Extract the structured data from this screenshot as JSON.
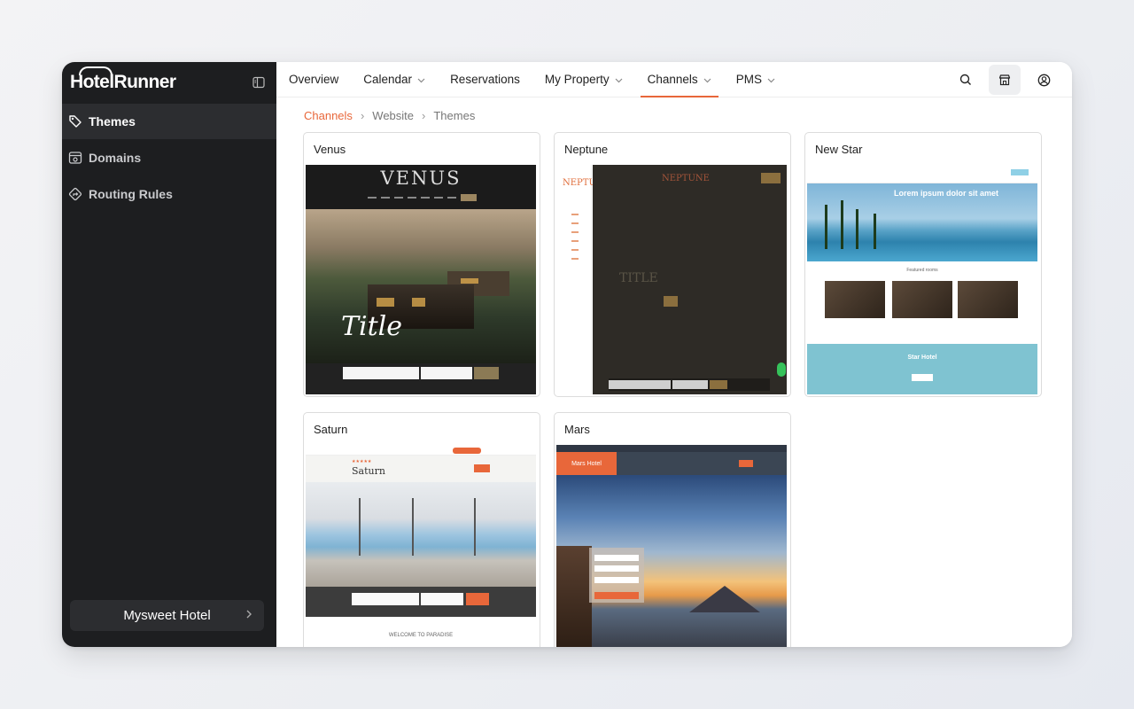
{
  "app": {
    "logo": "HotelRunner"
  },
  "sidebar": {
    "items": [
      {
        "label": "Themes",
        "icon": "palette-icon",
        "active": true
      },
      {
        "label": "Domains",
        "icon": "domain-icon",
        "active": false
      },
      {
        "label": "Routing Rules",
        "icon": "routing-icon",
        "active": false
      }
    ],
    "hotel": "Mysweet Hotel"
  },
  "topnav": {
    "tabs": [
      {
        "label": "Overview"
      },
      {
        "label": "Calendar"
      },
      {
        "label": "Reservations"
      },
      {
        "label": "My Property"
      },
      {
        "label": "Channels"
      },
      {
        "label": "PMS"
      }
    ],
    "active_tab": "Channels",
    "actions": [
      "search-icon",
      "store-icon",
      "user-icon"
    ]
  },
  "breadcrumb": {
    "root": "Channels",
    "mid": "Website",
    "current": "Themes"
  },
  "themes": [
    {
      "name": "Venus",
      "preview_brand": "VENUS",
      "preview_title": "Title"
    },
    {
      "name": "Neptune",
      "preview_brand": "NEPTUNE",
      "preview_title": "TITLE"
    },
    {
      "name": "New Star",
      "preview_title": "Lorem ipsum dolor sit amet",
      "preview_section": "Featured rooms",
      "preview_footer": "Star Hotel"
    },
    {
      "name": "Saturn",
      "preview_brand": "Saturn",
      "preview_footer": "WELCOME TO PARADISE"
    },
    {
      "name": "Mars",
      "preview_brand": "Mars Hotel"
    }
  ],
  "colors": {
    "accent": "#e8673a",
    "sidebar_bg": "#1d1e20"
  }
}
